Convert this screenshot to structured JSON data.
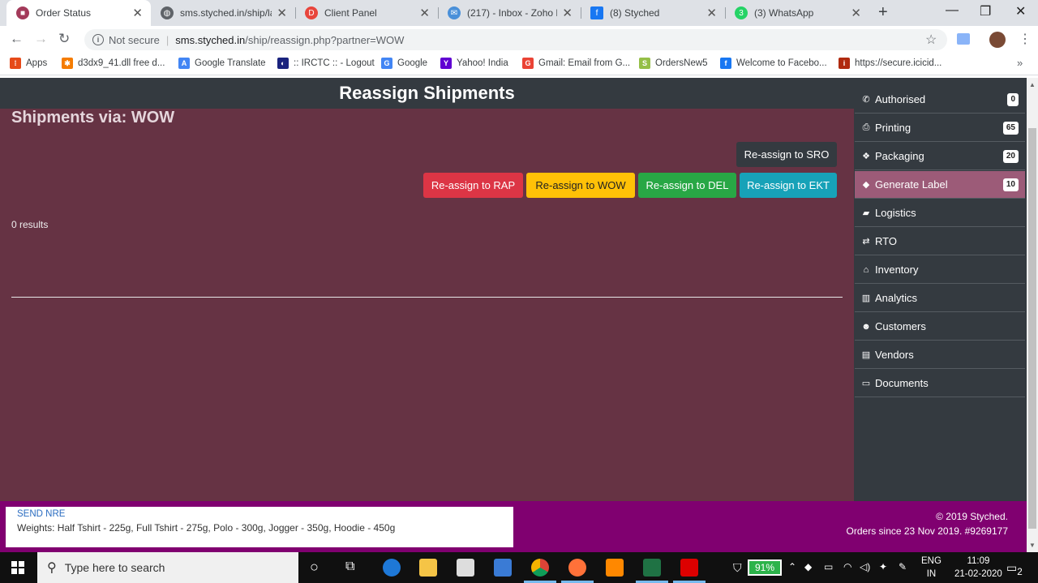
{
  "browser": {
    "tabs": [
      {
        "title": "Order Status",
        "active": true,
        "favicon_color": "#a33a5a"
      },
      {
        "title": "sms.styched.in/ship/lab",
        "active": false,
        "favicon_color": "#5f6368"
      },
      {
        "title": "Client Panel",
        "active": false,
        "favicon_color": "#e8453c"
      },
      {
        "title": "(217) - Inbox - Zoho M",
        "active": false,
        "favicon_color": "#4a90d9"
      },
      {
        "title": "(8) Styched",
        "active": false,
        "favicon_color": "#1877f2"
      },
      {
        "title": "(3) WhatsApp",
        "active": false,
        "favicon_color": "#25d366"
      }
    ],
    "url": {
      "security": "Not secure",
      "host": "sms.styched.in",
      "path": "/ship/reassign.php?partner=WOW"
    },
    "bookmarks": [
      {
        "label": "Apps",
        "color": "#e64a19"
      },
      {
        "label": "d3dx9_41.dll free d...",
        "color": "#f57c00"
      },
      {
        "label": "Google Translate",
        "color": "#4285f4"
      },
      {
        "label": ":: IRCTC :: - Logout",
        "color": "#1a237e"
      },
      {
        "label": "Google",
        "color": "#4285f4"
      },
      {
        "label": "Yahoo! India",
        "color": "#6001d2"
      },
      {
        "label": "Gmail: Email from G...",
        "color": "#ea4335"
      },
      {
        "label": "OrdersNew5",
        "color": "#95bf47"
      },
      {
        "label": "Welcome to Facebo...",
        "color": "#1877f2"
      },
      {
        "label": "https://secure.icicid...",
        "color": "#b02a0f"
      }
    ]
  },
  "page": {
    "header_title": "Reassign Shipments",
    "subtitle": "Shipments via: WOW",
    "buttons": {
      "sro": "Re-assign to SRO",
      "rap": "Re-assign to RAP",
      "wow": "Re-assign to WOW",
      "del": "Re-assign to DEL",
      "ekt": "Re-assign to EKT"
    },
    "results": "0 results"
  },
  "sidebar": {
    "items": [
      {
        "label": "Authorised",
        "icon": "phone-icon",
        "glyph": "✆",
        "badge": "0"
      },
      {
        "label": "Printing",
        "icon": "print-icon",
        "glyph": "⎙",
        "badge": "65"
      },
      {
        "label": "Packaging",
        "icon": "cubes-icon",
        "glyph": "❖",
        "badge": "20"
      },
      {
        "label": "Generate Label",
        "icon": "tags-icon",
        "glyph": "🏷",
        "badge": "10",
        "active": true
      },
      {
        "label": "Logistics",
        "icon": "truck-icon",
        "glyph": "⛟"
      },
      {
        "label": "RTO",
        "icon": "exchange-icon",
        "glyph": "⇄"
      },
      {
        "label": "Inventory",
        "icon": "home-icon",
        "glyph": "⌂"
      },
      {
        "label": "Analytics",
        "icon": "barcode-icon",
        "glyph": "▥"
      },
      {
        "label": "Customers",
        "icon": "user-icon",
        "glyph": "☻"
      },
      {
        "label": "Vendors",
        "icon": "file-icon",
        "glyph": "▤"
      },
      {
        "label": "Documents",
        "icon": "credit-card-icon",
        "glyph": "▭"
      }
    ]
  },
  "footer": {
    "send_link": "SEND NRE",
    "weights": "Weights: Half Tshirt - 225g, Full Tshirt - 275g, Polo - 300g, Jogger - 350g, Hoodie - 450g",
    "copyright": "© 2019 Styched.",
    "orders_since": "Orders since 23 Nov 2019. #9269177"
  },
  "taskbar": {
    "search_placeholder": "Type here to search",
    "battery": "91%",
    "lang_top": "ENG",
    "lang_bottom": "IN",
    "time": "11:09",
    "date": "21-02-2020",
    "notifications": "2"
  }
}
